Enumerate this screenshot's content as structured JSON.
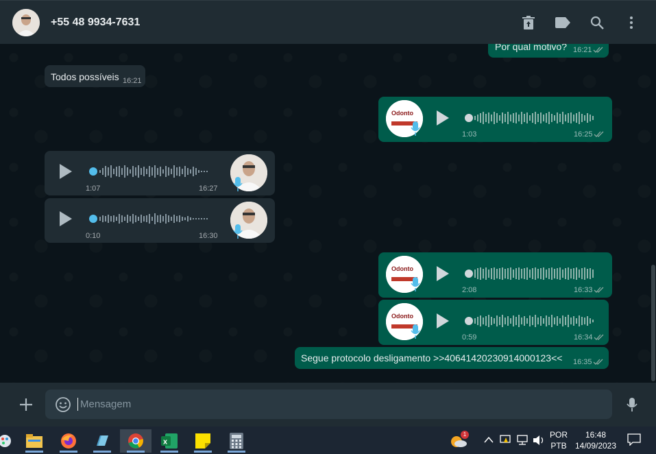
{
  "header": {
    "contact_name": "+55 48 9934-7631",
    "icons": [
      "delete-icon",
      "label-icon",
      "search-icon",
      "menu-icon"
    ]
  },
  "messages": [
    {
      "id": "m1",
      "direction": "out",
      "type": "text",
      "text": "Por qual motivo?",
      "time": "16:21",
      "ticks": "read"
    },
    {
      "id": "m2",
      "direction": "in",
      "type": "text",
      "text": "Todos possíveis",
      "time": "16:21"
    },
    {
      "id": "m3",
      "direction": "out",
      "type": "voice",
      "duration": "1:03",
      "time": "16:25",
      "ticks": "read",
      "progress": 0
    },
    {
      "id": "m4",
      "direction": "in",
      "type": "voice",
      "duration": "1:07",
      "time": "16:27",
      "progress": 0
    },
    {
      "id": "m5",
      "direction": "in",
      "type": "voice",
      "duration": "0:10",
      "time": "16:30",
      "progress": 0
    },
    {
      "id": "m6",
      "direction": "out",
      "type": "voice",
      "duration": "2:08",
      "time": "16:33",
      "ticks": "read",
      "progress": 0
    },
    {
      "id": "m7",
      "direction": "out",
      "type": "voice",
      "duration": "0:59",
      "time": "16:34",
      "ticks": "read",
      "progress": 0
    },
    {
      "id": "m8",
      "direction": "out",
      "type": "text",
      "text": "Segue protocolo desligamento >>40641420230914000123<<",
      "time": "16:35",
      "ticks": "read"
    }
  ],
  "composer": {
    "placeholder": "Mensagem"
  },
  "taskbar": {
    "apps": [
      "paint-icon",
      "file-explorer-icon",
      "firefox-icon",
      "notepad-icon",
      "chrome-icon",
      "excel-icon",
      "sticky-notes-icon",
      "calculator-icon"
    ],
    "weather_badge": "1",
    "language_line1": "POR",
    "language_line2": "PTB",
    "clock_time": "16:48",
    "clock_date": "14/09/2023"
  },
  "colors": {
    "incoming_bubble": "#202c33",
    "outgoing_bubble": "#005c4b",
    "read_ticks": "#53bdeb",
    "background": "#0b141a",
    "voice_dot_in": "#53bdeb"
  }
}
